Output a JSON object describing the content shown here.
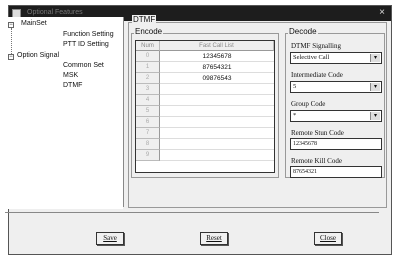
{
  "window": {
    "title": "Optional Features",
    "close_glyph": "×"
  },
  "tree": {
    "items": [
      {
        "label": "MainSet"
      },
      {
        "label": "Function Setting"
      },
      {
        "label": "PTT ID Setting"
      },
      {
        "label": "Option Signal"
      },
      {
        "label": "Common Set"
      },
      {
        "label": "MSK"
      },
      {
        "label": "DTMF"
      }
    ]
  },
  "dtmf": {
    "group_label": "DTMF",
    "encode": {
      "label": "Encode",
      "columns": [
        "Num",
        "Fast Call List"
      ],
      "rows": [
        {
          "num": "0",
          "value": "12345678"
        },
        {
          "num": "1",
          "value": "87654321"
        },
        {
          "num": "2",
          "value": "09876543"
        },
        {
          "num": "3",
          "value": ""
        },
        {
          "num": "4",
          "value": ""
        },
        {
          "num": "5",
          "value": ""
        },
        {
          "num": "6",
          "value": ""
        },
        {
          "num": "7",
          "value": ""
        },
        {
          "num": "8",
          "value": ""
        },
        {
          "num": "9",
          "value": ""
        }
      ]
    },
    "decode": {
      "label": "Decode",
      "signalling_label": "DTMF Signalling",
      "signalling_value": "Selective Call",
      "intermediate_label": "Intermediate Code",
      "intermediate_value": "5",
      "group_code_label": "Group Code",
      "group_code_value": "*",
      "stun_label": "Remote Stun Code",
      "stun_value": "12345678",
      "kill_label": "Remote Kill Code",
      "kill_value": "87654321"
    }
  },
  "buttons": {
    "save": "Save",
    "reset": "Reset",
    "close": "Close"
  },
  "icons": {
    "dropdown_arrow": "▾",
    "minus": "−"
  }
}
